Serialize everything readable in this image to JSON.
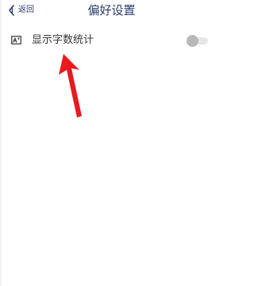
{
  "navbar": {
    "back_label": "返回",
    "title": "偏好设置"
  },
  "settings": {
    "word_count": {
      "label": "显示字数统计",
      "enabled": false
    }
  },
  "icons": {
    "back": "chevron-left-icon",
    "row": "text-stats-icon",
    "annotation": "red-arrow"
  },
  "colors": {
    "title": "#2b3a6b",
    "annotation": "#e8191f",
    "toggle_off_knob": "#b8b8b8",
    "toggle_off_track": "#e6e6e6"
  }
}
